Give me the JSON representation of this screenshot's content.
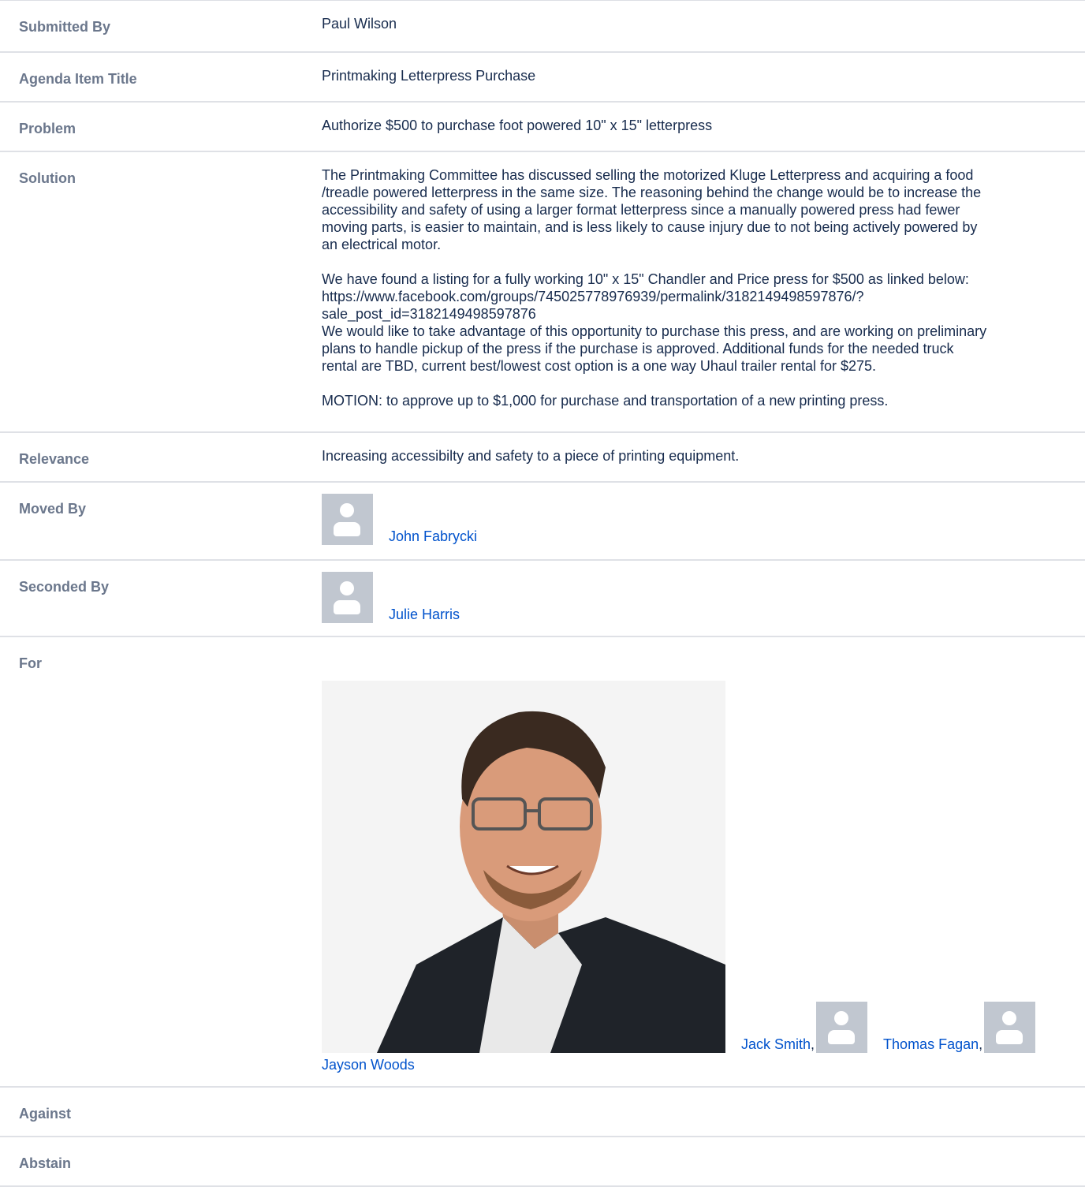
{
  "rows": {
    "submitted_by": {
      "label": "Submitted By",
      "value": "Paul Wilson"
    },
    "agenda_item_title": {
      "label": "Agenda Item Title",
      "value": "Printmaking Letterpress Purchase"
    },
    "problem": {
      "label": "Problem",
      "value": "Authorize $500 to purchase foot powered 10\" x 15\" letterpress"
    },
    "solution": {
      "label": "Solution",
      "para1_line1": "The Printmaking Committee has discussed selling the motorized Kluge Letterpress and acquiring a food",
      "para1_line2": "/treadle powered letterpress in the same size. The reasoning behind the change would be to increase the",
      "para1_line3": "accessibility and safety of using a larger format letterpress since a manually powered press had fewer",
      "para1_line4": "moving parts, is easier to maintain, and is less likely to cause injury due to not being actively powered by",
      "para1_line5": "an electrical motor.",
      "para2_line1": "We have found a listing for a fully working 10\" x 15\" Chandler and Price press for $500 as linked below:",
      "para2_line2": "https://www.facebook.com/groups/745025778976939/permalink/3182149498597876/?",
      "para2_line3": "sale_post_id=3182149498597876",
      "para2_line4": "We would like to take advantage of this opportunity to purchase this press, and are working on preliminary",
      "para2_line5": "plans to handle pickup of the press if the purchase is approved. Additional funds for the needed truck",
      "para2_line6": "rental are TBD, current best/lowest cost option is a one way Uhaul trailer rental for $275.",
      "para3": "MOTION: to approve up to $1,000 for purchase and transportation of a new printing press."
    },
    "relevance": {
      "label": "Relevance",
      "value": "Increasing accessibilty and safety to a piece of printing equipment."
    },
    "moved_by": {
      "label": "Moved By",
      "name": "John Fabrycki"
    },
    "seconded_by": {
      "label": "Seconded By",
      "name": "Julie Harris"
    },
    "for": {
      "label": "For",
      "names": [
        "Jack Smith",
        "Thomas Fagan",
        "Jayson Woods"
      ],
      "separator": ","
    },
    "against": {
      "label": "Against"
    },
    "abstain": {
      "label": "Abstain"
    }
  },
  "colors": {
    "label_bg": "#f4f5f7",
    "label_text": "#6b778c",
    "link": "#0052cc",
    "border": "#dfe1e6",
    "avatar_bg": "#c1c7d0"
  }
}
